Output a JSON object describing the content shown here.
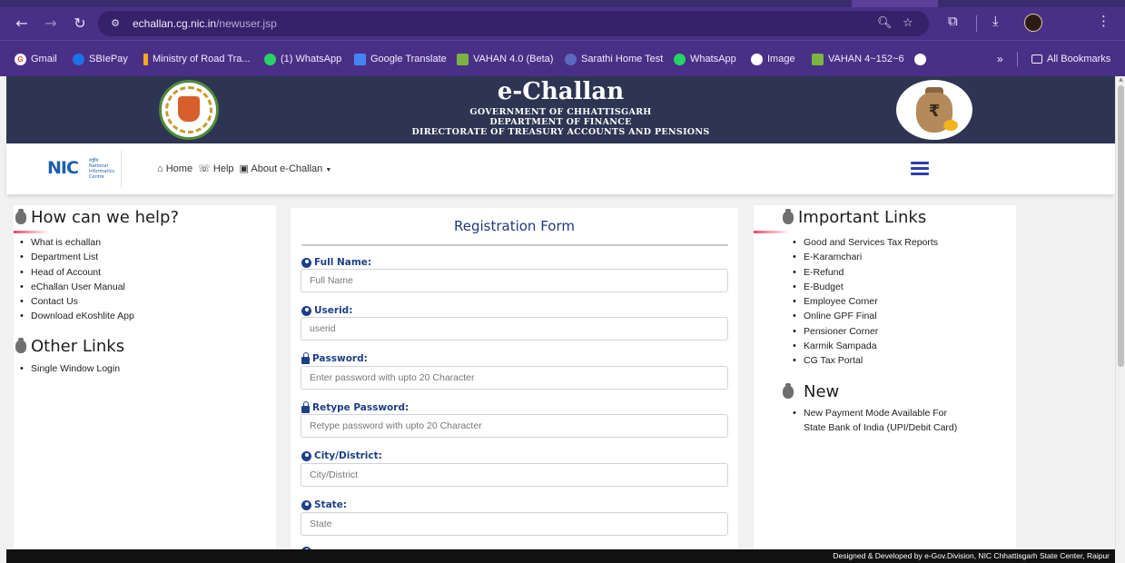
{
  "browser": {
    "url_host": "echallan.cg.nic.in",
    "url_path": "/newuser.jsp",
    "bookmarks": [
      {
        "label": "Gmail",
        "color": "#ea4335",
        "glyph": "G"
      },
      {
        "label": "SBIePay",
        "color": "#1a73e8",
        "glyph": ""
      },
      {
        "label": "Ministry of Road Tra...",
        "color": "#f9a825",
        "glyph": ""
      },
      {
        "label": "(1) WhatsApp",
        "color": "#25d366",
        "glyph": "1"
      },
      {
        "label": "Google Translate",
        "color": "#4285f4",
        "glyph": "G"
      },
      {
        "label": "VAHAN 4.0 (Beta)",
        "color": "#7cb342",
        "glyph": "V"
      },
      {
        "label": "Sarathi Home Test",
        "color": "#5c6bc0",
        "glyph": ""
      },
      {
        "label": "WhatsApp",
        "color": "#25d366",
        "glyph": "W"
      },
      {
        "label": "Image",
        "color": "#333333",
        "glyph": "I"
      },
      {
        "label": "VAHAN 4~152~6",
        "color": "#7cb342",
        "glyph": "V"
      },
      {
        "label": "",
        "color": "#333333",
        "glyph": ""
      }
    ],
    "overflow_label": "»",
    "all_bookmarks_label": "All Bookmarks"
  },
  "header": {
    "title": "e-Challan",
    "line1": "GOVERNMENT OF CHHATTISGARH",
    "line2": "DEPARTMENT OF FINANCE",
    "line3": "DIRECTORATE OF TREASURY ACCOUNTS AND PENSIONS"
  },
  "nav": {
    "logo_text": "NIC",
    "logo_sub": "राष्ट्रीय National Informatics Centre",
    "home": "Home",
    "help": "Help",
    "about": "About e-Challan"
  },
  "left": {
    "help_title": "How can we help?",
    "help_items": [
      "What is echallan",
      "Department List",
      "Head of Account",
      "eChallan User Manual",
      "Contact Us",
      "Download eKoshlite App"
    ],
    "other_title": "Other Links",
    "other_items": [
      "Single Window Login"
    ]
  },
  "form": {
    "title": "Registration Form",
    "fields": [
      {
        "label": "Full Name:",
        "placeholder": "Full Name",
        "icon": "user-circle-icon"
      },
      {
        "label": "Userid:",
        "placeholder": "userid",
        "icon": "user-circle-icon"
      },
      {
        "label": "Password:",
        "placeholder": "Enter password with upto 20 Character",
        "icon": "lock-icon"
      },
      {
        "label": "Retype Password:",
        "placeholder": "Retype password with upto 20 Character",
        "icon": "lock-icon"
      },
      {
        "label": "City/District:",
        "placeholder": "City/District",
        "icon": "user-circle-icon"
      },
      {
        "label": "State:",
        "placeholder": "State",
        "icon": "user-circle-icon"
      }
    ]
  },
  "right": {
    "links_title": "Important Links",
    "links": [
      "Good and Services Tax Reports",
      "E-Karamchari",
      "E-Refund",
      "E-Budget",
      "Employee Corner",
      "Online GPF Final",
      "Pensioner Corner",
      "Karmik Sampada",
      "CG Tax Portal"
    ],
    "new_title": "New",
    "new_items": [
      "New Payment Mode Available For",
      "State Bank of India (UPI/Debit Card)"
    ]
  },
  "footer": {
    "text": "Designed & Developed by e-Gov.Division, NIC Chhattisgarh State Center, Raipur"
  }
}
